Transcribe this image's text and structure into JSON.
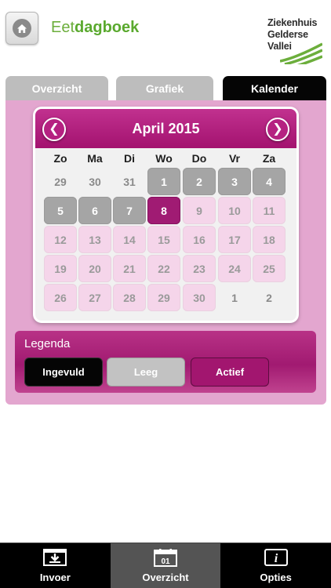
{
  "header": {
    "title_prefix": "Eet",
    "title_bold": "dagboek",
    "logo_lines": [
      "Ziekenhuis",
      "Gelderse",
      "Vallei"
    ],
    "accent_color": "#5aa92e",
    "home_icon": "home-icon"
  },
  "tabs": [
    {
      "label": "Overzicht",
      "active": false
    },
    {
      "label": "Grafiek",
      "active": false
    },
    {
      "label": "Kalender",
      "active": true
    }
  ],
  "calendar": {
    "month_label": "April 2015",
    "prev_icon": "chevron-left-icon",
    "next_icon": "chevron-right-icon",
    "weekdays": [
      "Zo",
      "Ma",
      "Di",
      "Wo",
      "Do",
      "Vr",
      "Za"
    ],
    "weeks": [
      [
        {
          "day": "29",
          "state": "other"
        },
        {
          "day": "30",
          "state": "other"
        },
        {
          "day": "31",
          "state": "other"
        },
        {
          "day": "1",
          "state": "filled"
        },
        {
          "day": "2",
          "state": "filled"
        },
        {
          "day": "3",
          "state": "filled"
        },
        {
          "day": "4",
          "state": "filled"
        }
      ],
      [
        {
          "day": "5",
          "state": "filled"
        },
        {
          "day": "6",
          "state": "filled"
        },
        {
          "day": "7",
          "state": "filled"
        },
        {
          "day": "8",
          "state": "active"
        },
        {
          "day": "9",
          "state": "empty"
        },
        {
          "day": "10",
          "state": "empty"
        },
        {
          "day": "11",
          "state": "empty"
        }
      ],
      [
        {
          "day": "12",
          "state": "empty"
        },
        {
          "day": "13",
          "state": "empty"
        },
        {
          "day": "14",
          "state": "empty"
        },
        {
          "day": "15",
          "state": "empty"
        },
        {
          "day": "16",
          "state": "empty"
        },
        {
          "day": "17",
          "state": "empty"
        },
        {
          "day": "18",
          "state": "empty"
        }
      ],
      [
        {
          "day": "19",
          "state": "empty"
        },
        {
          "day": "20",
          "state": "empty"
        },
        {
          "day": "21",
          "state": "empty"
        },
        {
          "day": "22",
          "state": "empty"
        },
        {
          "day": "23",
          "state": "empty"
        },
        {
          "day": "24",
          "state": "empty"
        },
        {
          "day": "25",
          "state": "empty"
        }
      ],
      [
        {
          "day": "26",
          "state": "empty"
        },
        {
          "day": "27",
          "state": "empty"
        },
        {
          "day": "28",
          "state": "empty"
        },
        {
          "day": "29",
          "state": "empty"
        },
        {
          "day": "30",
          "state": "empty"
        },
        {
          "day": "1",
          "state": "other"
        },
        {
          "day": "2",
          "state": "other"
        }
      ]
    ]
  },
  "legend": {
    "title": "Legenda",
    "items": [
      {
        "label": "Ingevuld",
        "color": "#050505"
      },
      {
        "label": "Leeg",
        "color": "#c2c2c2"
      },
      {
        "label": "Actief",
        "color": "#a2166f"
      }
    ]
  },
  "bottom_nav": [
    {
      "label": "Invoer",
      "icon": "download-tray-icon",
      "active": false
    },
    {
      "label": "Overzicht",
      "icon": "calendar-icon",
      "icon_text": "01",
      "active": true
    },
    {
      "label": "Opties",
      "icon": "info-icon",
      "icon_text": "i",
      "active": false
    }
  ],
  "colors": {
    "brand_magenta": "#a01b73",
    "panel_pink": "#e3a6cf",
    "empty_day": "#f5d5ea",
    "filled_day": "#a5a5a5"
  }
}
